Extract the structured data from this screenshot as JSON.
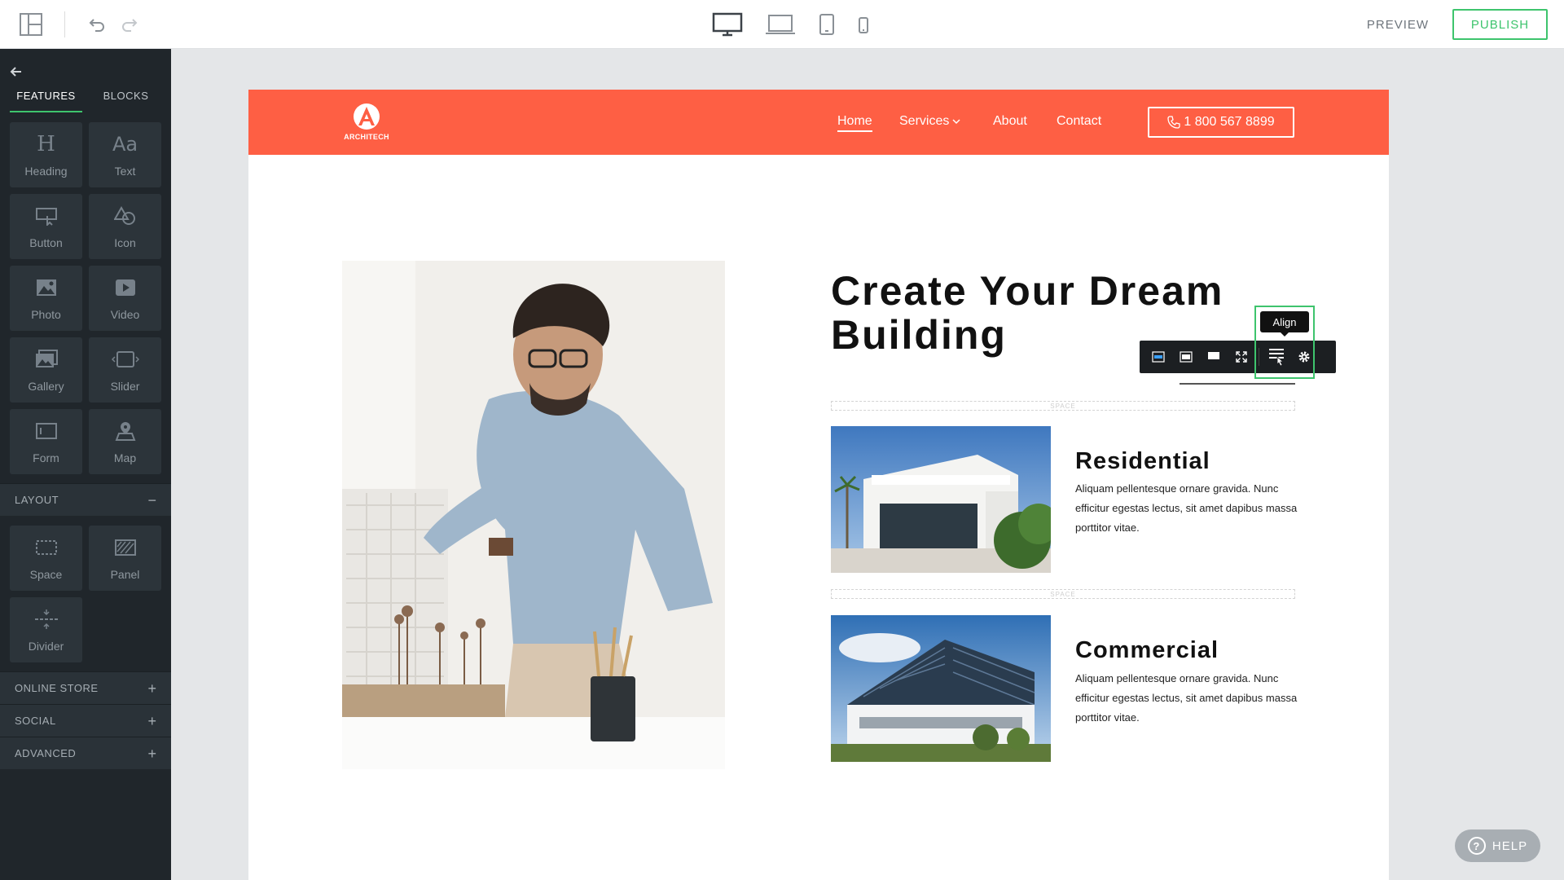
{
  "topbar": {
    "layout_icon": "layout-panels-icon",
    "undo_icon": "undo-icon",
    "redo_icon": "redo-icon",
    "devices": [
      "desktop-icon",
      "laptop-icon",
      "tablet-icon",
      "mobile-icon"
    ],
    "preview_label": "PREVIEW",
    "publish_label": "PUBLISH",
    "accent_color": "#3ec46d"
  },
  "sidebar": {
    "tabs": [
      {
        "label": "FEATURES",
        "active": true
      },
      {
        "label": "BLOCKS",
        "active": false
      }
    ],
    "features": [
      {
        "label": "Heading",
        "icon": "heading-icon"
      },
      {
        "label": "Text",
        "icon": "text-icon"
      },
      {
        "label": "Button",
        "icon": "button-icon"
      },
      {
        "label": "Icon",
        "icon": "shapes-icon"
      },
      {
        "label": "Photo",
        "icon": "photo-icon"
      },
      {
        "label": "Video",
        "icon": "video-icon"
      },
      {
        "label": "Gallery",
        "icon": "gallery-icon"
      },
      {
        "label": "Slider",
        "icon": "slider-icon"
      },
      {
        "label": "Form",
        "icon": "form-icon"
      },
      {
        "label": "Map",
        "icon": "map-icon"
      }
    ],
    "layout_section": {
      "label": "LAYOUT",
      "toggle": "−"
    },
    "layout_items": [
      {
        "label": "Space",
        "icon": "space-icon"
      },
      {
        "label": "Panel",
        "icon": "panel-icon"
      },
      {
        "label": "Divider",
        "icon": "divider-icon"
      }
    ],
    "sections": [
      {
        "label": "ONLINE STORE",
        "toggle": "+"
      },
      {
        "label": "SOCIAL",
        "toggle": "+"
      },
      {
        "label": "ADVANCED",
        "toggle": "+"
      }
    ]
  },
  "site": {
    "brand_color": "#fe5f44",
    "logo_text": "ARCHITECH",
    "nav": {
      "home": "Home",
      "services": "Services",
      "about": "About",
      "contact": "Contact",
      "phone": "1 800 567 8899"
    },
    "headline": "Create Your Dream Building",
    "space_label": "SPACE",
    "cards": [
      {
        "title": "Residential",
        "text": "Aliquam pellentesque ornare gravida. Nunc efficitur egestas lectus, sit amet dapibus massa porttitor vitae."
      },
      {
        "title": "Commercial",
        "text": "Aliquam pellentesque ornare gravida. Nunc efficitur egestas lectus, sit amet dapibus massa porttitor vitae."
      }
    ]
  },
  "element_toolbar": {
    "tooltip": "Align",
    "buttons": [
      "width-small-icon",
      "width-medium-icon",
      "width-large-icon",
      "fullscreen-icon",
      "align-icon",
      "settings-gear-icon"
    ]
  },
  "help": {
    "label": "HELP"
  }
}
